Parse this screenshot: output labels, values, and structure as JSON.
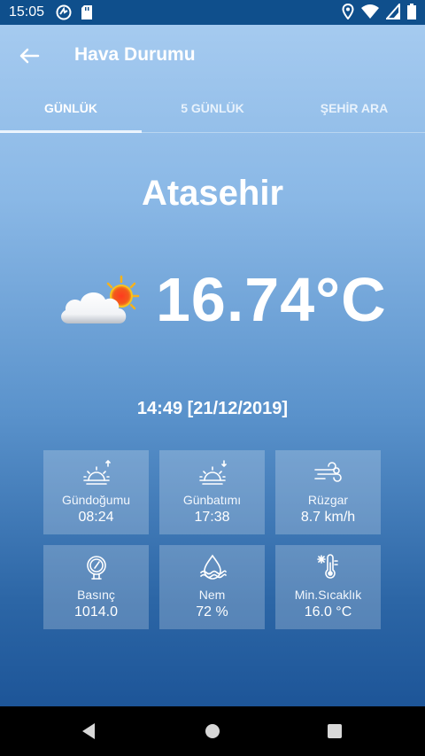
{
  "status": {
    "time": "15:05"
  },
  "app": {
    "title": "Hava Durumu"
  },
  "tabs": [
    {
      "label": "GÜNLÜK",
      "active": true
    },
    {
      "label": "5 GÜNLÜK",
      "active": false
    },
    {
      "label": "ŞEHİR ARA",
      "active": false
    }
  ],
  "weather": {
    "city": "Atasehir",
    "temperature": "16.74°C",
    "datetime": "14:49 [21/12/2019]",
    "icon": "partly-cloudy-icon"
  },
  "details": [
    {
      "label": "Gündoğumu",
      "value": "08:24",
      "icon": "sunrise-icon"
    },
    {
      "label": "Günbatımı",
      "value": "17:38",
      "icon": "sunset-icon"
    },
    {
      "label": "Rüzgar",
      "value": "8.7 km/h",
      "icon": "wind-icon"
    },
    {
      "label": "Basınç",
      "value": "1014.0",
      "icon": "pressure-gauge-icon"
    },
    {
      "label": "Nem",
      "value": "72 %",
      "icon": "humidity-icon"
    },
    {
      "label": "Min.Sıcaklık",
      "value": "16.0 °C",
      "icon": "thermometer-icon"
    }
  ],
  "colors": {
    "status_bar": "#0f4f8c",
    "background_top": "#a9cdf1",
    "background_bottom": "#1d5598"
  }
}
